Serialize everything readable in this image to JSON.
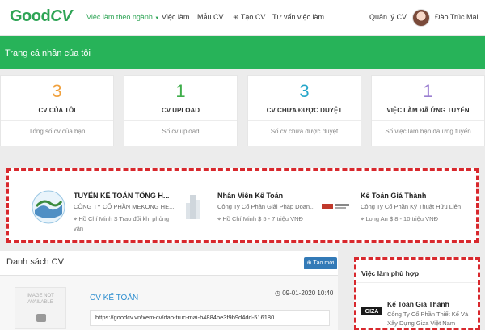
{
  "header": {
    "logo_left": "Good",
    "logo_right": "CV",
    "nav": [
      {
        "label": "Việc làm theo ngành"
      },
      {
        "label": "Việc làm"
      },
      {
        "label": "Mẫu CV"
      },
      {
        "label": "Tạo CV"
      },
      {
        "label": "Tư vấn việc làm"
      }
    ],
    "manage_cv": "Quản lý CV",
    "user_name": "Đào Trúc Mai"
  },
  "banner": {
    "title": "Trang cá nhân của tôi"
  },
  "stats": [
    {
      "value": "3",
      "label": "CV CỦA TÔI",
      "desc": "Tổng số cv của bạn",
      "color": "#f0a03c"
    },
    {
      "value": "1",
      "label": "CV UPLOAD",
      "desc": "Số cv upload",
      "color": "#3fae4b"
    },
    {
      "value": "3",
      "label": "CV CHƯA ĐƯỢC DUYỆT",
      "desc": "Số cv chưa được duyệt",
      "color": "#25a6c9"
    },
    {
      "value": "1",
      "label": "VIỆC LÀM ĐÃ ỨNG TUYỂN",
      "desc": "Số việc làm bạn đã ứng tuyển",
      "color": "#9b7fd1"
    }
  ],
  "jobs": [
    {
      "title": "TUYỂN KẾ TOÁN TỔNG H...",
      "company": "CÔNG TY CỔ PHẦN MEKONG HE...",
      "location": "Hồ Chí Minh",
      "salary": "Trao đổi khi phỏng vấn"
    },
    {
      "title": "Nhân Viên Kế Toán",
      "company": "Công Ty Cổ Phần Giải Pháp Doan...",
      "location": "Hồ Chí Minh",
      "salary": "5 - 7 triệu VNĐ"
    },
    {
      "title": "Kế Toán Giá Thành",
      "company": "Công Ty Cổ Phần Kỹ Thuật Hữu Liên",
      "location": "Long An",
      "salary": "8 - 10 triệu VNĐ"
    }
  ],
  "cv_list": {
    "heading": "Danh sách CV",
    "new_button": "Tạo mới",
    "items": [
      {
        "thumb_text": "IMAGE NOT AVAILABLE",
        "title": "CV KẾ TOÁN",
        "date": "09-01-2020 10:40",
        "link": "https://goodcv.vn/xem-cv/dao-truc-mai-b4884be3f9b9d4dd-516180"
      }
    ]
  },
  "suitable_jobs": {
    "heading": "Việc làm phù hợp",
    "items": [
      {
        "logo_text": "GIZA",
        "title": "Kế Toán Giá Thành",
        "company": "Công Ty Cổ Phần Thiết Kế Và Xây Dựng Giza Việt Nam"
      }
    ]
  },
  "colors": {
    "brand": "#27b359",
    "accent_link": "#2f8fd0",
    "highlight_border": "#d8282d",
    "button": "#337ab7"
  }
}
